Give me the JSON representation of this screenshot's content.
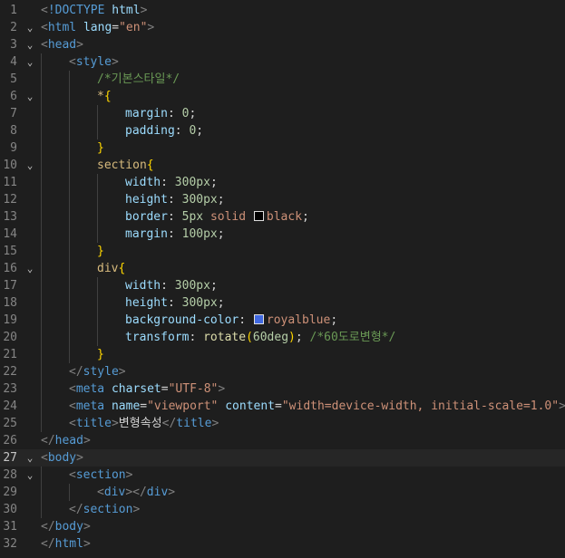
{
  "editor": {
    "colors": {
      "background": "#1e1e1e",
      "line_number": "#858585",
      "tag": "#569cd6",
      "attribute": "#9cdcfe",
      "string": "#ce9178",
      "comment": "#6a9955",
      "number": "#b5cea8"
    },
    "active_line": 27,
    "lines": [
      {
        "n": "1",
        "fold": "",
        "indent": 0,
        "tokens": [
          [
            "punc",
            "<"
          ],
          [
            "tag",
            "!DOCTYPE"
          ],
          [
            "plain",
            " "
          ],
          [
            "attr",
            "html"
          ],
          [
            "punc",
            ">"
          ]
        ]
      },
      {
        "n": "2",
        "fold": "⌄",
        "indent": 0,
        "tokens": [
          [
            "punc",
            "<"
          ],
          [
            "tag",
            "html"
          ],
          [
            "plain",
            " "
          ],
          [
            "attr",
            "lang"
          ],
          [
            "plain",
            "="
          ],
          [
            "str",
            "\"en\""
          ],
          [
            "punc",
            ">"
          ]
        ]
      },
      {
        "n": "3",
        "fold": "⌄",
        "indent": 0,
        "tokens": [
          [
            "punc",
            "<"
          ],
          [
            "tag",
            "head"
          ],
          [
            "punc",
            ">"
          ]
        ]
      },
      {
        "n": "4",
        "fold": "⌄",
        "indent": 1,
        "tokens": [
          [
            "punc",
            "<"
          ],
          [
            "tag",
            "style"
          ],
          [
            "punc",
            ">"
          ]
        ]
      },
      {
        "n": "5",
        "fold": "",
        "indent": 2,
        "tokens": [
          [
            "com",
            "/*기본스타일*/"
          ]
        ]
      },
      {
        "n": "6",
        "fold": "⌄",
        "indent": 2,
        "tokens": [
          [
            "sel",
            "*"
          ],
          [
            "brace",
            "{"
          ]
        ]
      },
      {
        "n": "7",
        "fold": "",
        "indent": 3,
        "tokens": [
          [
            "prop",
            "margin"
          ],
          [
            "plain",
            ": "
          ],
          [
            "num",
            "0"
          ],
          [
            "plain",
            ";"
          ]
        ]
      },
      {
        "n": "8",
        "fold": "",
        "indent": 3,
        "tokens": [
          [
            "prop",
            "padding"
          ],
          [
            "plain",
            ": "
          ],
          [
            "num",
            "0"
          ],
          [
            "plain",
            ";"
          ]
        ]
      },
      {
        "n": "9",
        "fold": "",
        "indent": 2,
        "tokens": [
          [
            "brace",
            "}"
          ]
        ]
      },
      {
        "n": "10",
        "fold": "⌄",
        "indent": 2,
        "tokens": [
          [
            "sel",
            "section"
          ],
          [
            "brace",
            "{"
          ]
        ]
      },
      {
        "n": "11",
        "fold": "",
        "indent": 3,
        "tokens": [
          [
            "prop",
            "width"
          ],
          [
            "plain",
            ": "
          ],
          [
            "num",
            "300px"
          ],
          [
            "plain",
            ";"
          ]
        ]
      },
      {
        "n": "12",
        "fold": "",
        "indent": 3,
        "tokens": [
          [
            "prop",
            "height"
          ],
          [
            "plain",
            ": "
          ],
          [
            "num",
            "300px"
          ],
          [
            "plain",
            ";"
          ]
        ]
      },
      {
        "n": "13",
        "fold": "",
        "indent": 3,
        "tokens": [
          [
            "prop",
            "border"
          ],
          [
            "plain",
            ": "
          ],
          [
            "num",
            "5px"
          ],
          [
            "plain",
            " "
          ],
          [
            "val",
            "solid"
          ],
          [
            "plain",
            " "
          ],
          [
            "swatch",
            "#000000"
          ],
          [
            "val",
            "black"
          ],
          [
            "plain",
            ";"
          ]
        ]
      },
      {
        "n": "14",
        "fold": "",
        "indent": 3,
        "tokens": [
          [
            "prop",
            "margin"
          ],
          [
            "plain",
            ": "
          ],
          [
            "num",
            "100px"
          ],
          [
            "plain",
            ";"
          ]
        ]
      },
      {
        "n": "15",
        "fold": "",
        "indent": 2,
        "tokens": [
          [
            "brace",
            "}"
          ]
        ]
      },
      {
        "n": "16",
        "fold": "⌄",
        "indent": 2,
        "tokens": [
          [
            "sel",
            "div"
          ],
          [
            "brace",
            "{"
          ]
        ]
      },
      {
        "n": "17",
        "fold": "",
        "indent": 3,
        "tokens": [
          [
            "prop",
            "width"
          ],
          [
            "plain",
            ": "
          ],
          [
            "num",
            "300px"
          ],
          [
            "plain",
            ";"
          ]
        ]
      },
      {
        "n": "18",
        "fold": "",
        "indent": 3,
        "tokens": [
          [
            "prop",
            "height"
          ],
          [
            "plain",
            ": "
          ],
          [
            "num",
            "300px"
          ],
          [
            "plain",
            ";"
          ]
        ]
      },
      {
        "n": "19",
        "fold": "",
        "indent": 3,
        "tokens": [
          [
            "prop",
            "background-color"
          ],
          [
            "plain",
            ": "
          ],
          [
            "swatch",
            "#4169e1"
          ],
          [
            "val",
            "royalblue"
          ],
          [
            "plain",
            ";"
          ]
        ]
      },
      {
        "n": "20",
        "fold": "",
        "indent": 3,
        "tokens": [
          [
            "prop",
            "transform"
          ],
          [
            "plain",
            ": "
          ],
          [
            "fn",
            "rotate"
          ],
          [
            "brace",
            "("
          ],
          [
            "num",
            "60deg"
          ],
          [
            "brace",
            ")"
          ],
          [
            "plain",
            "; "
          ],
          [
            "com",
            "/*60도로변형*/"
          ]
        ]
      },
      {
        "n": "21",
        "fold": "",
        "indent": 2,
        "tokens": [
          [
            "brace",
            "}"
          ]
        ]
      },
      {
        "n": "22",
        "fold": "",
        "indent": 1,
        "tokens": [
          [
            "punc",
            "</"
          ],
          [
            "tag",
            "style"
          ],
          [
            "punc",
            ">"
          ]
        ]
      },
      {
        "n": "23",
        "fold": "",
        "indent": 1,
        "tokens": [
          [
            "punc",
            "<"
          ],
          [
            "tag",
            "meta"
          ],
          [
            "plain",
            " "
          ],
          [
            "attr",
            "charset"
          ],
          [
            "plain",
            "="
          ],
          [
            "str",
            "\"UTF-8\""
          ],
          [
            "punc",
            ">"
          ]
        ]
      },
      {
        "n": "24",
        "fold": "",
        "indent": 1,
        "tokens": [
          [
            "punc",
            "<"
          ],
          [
            "tag",
            "meta"
          ],
          [
            "plain",
            " "
          ],
          [
            "attr",
            "name"
          ],
          [
            "plain",
            "="
          ],
          [
            "str",
            "\"viewport\""
          ],
          [
            "plain",
            " "
          ],
          [
            "attr",
            "content"
          ],
          [
            "plain",
            "="
          ],
          [
            "str",
            "\"width=device-width, initial-scale=1.0\""
          ],
          [
            "punc",
            ">"
          ]
        ]
      },
      {
        "n": "25",
        "fold": "",
        "indent": 1,
        "tokens": [
          [
            "punc",
            "<"
          ],
          [
            "tag",
            "title"
          ],
          [
            "punc",
            ">"
          ],
          [
            "plain",
            "변형속성"
          ],
          [
            "punc",
            "</"
          ],
          [
            "tag",
            "title"
          ],
          [
            "punc",
            ">"
          ]
        ]
      },
      {
        "n": "26",
        "fold": "",
        "indent": 0,
        "tokens": [
          [
            "punc",
            "</"
          ],
          [
            "tag",
            "head"
          ],
          [
            "punc",
            ">"
          ]
        ]
      },
      {
        "n": "27",
        "fold": "⌄",
        "indent": 0,
        "tokens": [
          [
            "punc",
            "<"
          ],
          [
            "tag",
            "body"
          ],
          [
            "punc",
            ">"
          ]
        ]
      },
      {
        "n": "28",
        "fold": "⌄",
        "indent": 1,
        "tokens": [
          [
            "punc",
            "<"
          ],
          [
            "tag",
            "section"
          ],
          [
            "punc",
            ">"
          ]
        ]
      },
      {
        "n": "29",
        "fold": "",
        "indent": 2,
        "tokens": [
          [
            "punc",
            "<"
          ],
          [
            "tag",
            "div"
          ],
          [
            "punc",
            "></"
          ],
          [
            "tag",
            "div"
          ],
          [
            "punc",
            ">"
          ]
        ]
      },
      {
        "n": "30",
        "fold": "",
        "indent": 1,
        "tokens": [
          [
            "punc",
            "</"
          ],
          [
            "tag",
            "section"
          ],
          [
            "punc",
            ">"
          ]
        ]
      },
      {
        "n": "31",
        "fold": "",
        "indent": 0,
        "tokens": [
          [
            "punc",
            "</"
          ],
          [
            "tag",
            "body"
          ],
          [
            "punc",
            ">"
          ]
        ]
      },
      {
        "n": "32",
        "fold": "",
        "indent": 0,
        "tokens": [
          [
            "punc",
            "</"
          ],
          [
            "tag",
            "html"
          ],
          [
            "punc",
            ">"
          ]
        ]
      }
    ]
  }
}
